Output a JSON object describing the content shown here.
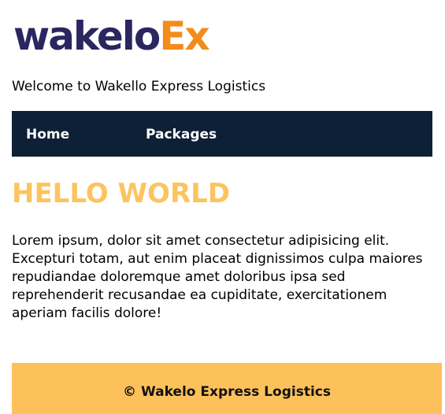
{
  "header": {
    "logo_text_main": "wakelo",
    "logo_text_accent": "Ex",
    "welcome": "Welcome to Wakello Express Logistics"
  },
  "nav": {
    "items": [
      {
        "label": "Home"
      },
      {
        "label": "Packages"
      }
    ]
  },
  "main": {
    "title": "HELLO WORLD",
    "paragraph": "Lorem ipsum, dolor sit amet consectetur adipisicing elit. Excepturi totam, aut enim placeat dignissimos culpa maiores repudiandae doloremque amet doloribus ipsa sed reprehenderit recusandae ea cupiditate, exercitationem aperiam facilis dolore!"
  },
  "footer": {
    "text": "© Wakelo Express Logistics"
  },
  "colors": {
    "logo_primary": "#2b2560",
    "logo_accent": "#f28c1a",
    "nav_background": "#0e2036",
    "title": "#fcc45f",
    "footer_background": "#fdc15c"
  }
}
